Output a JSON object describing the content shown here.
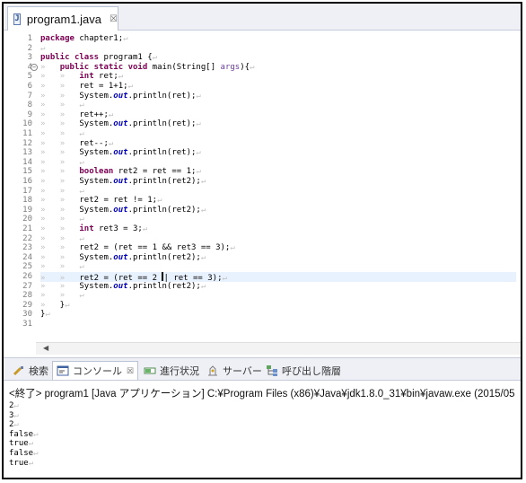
{
  "editor": {
    "tab": {
      "label": "program1.java",
      "icon": "java-file-icon",
      "close": "☒"
    },
    "lines": [
      {
        "n": "1",
        "text": "package chapter1;",
        "kind": "package"
      },
      {
        "n": "2",
        "text": "",
        "kind": "blank"
      },
      {
        "n": "3",
        "text": "public class program1 {",
        "kind": "class"
      },
      {
        "n": "4",
        "text": "public static void main(String[] args){",
        "kind": "main"
      },
      {
        "n": "5",
        "text": "int ret;",
        "kind": "decl"
      },
      {
        "n": "6",
        "text": "ret = 1+1;",
        "kind": "plain"
      },
      {
        "n": "7",
        "text": "System.out.println(ret);",
        "kind": "print"
      },
      {
        "n": "8",
        "text": "",
        "kind": "blank"
      },
      {
        "n": "9",
        "text": "ret++;",
        "kind": "plain"
      },
      {
        "n": "10",
        "text": "System.out.println(ret);",
        "kind": "print"
      },
      {
        "n": "11",
        "text": "",
        "kind": "blank"
      },
      {
        "n": "12",
        "text": "ret--;",
        "kind": "plain"
      },
      {
        "n": "13",
        "text": "System.out.println(ret);",
        "kind": "print"
      },
      {
        "n": "14",
        "text": "",
        "kind": "blank"
      },
      {
        "n": "15",
        "text": "boolean ret2 = ret == 1;",
        "kind": "decl"
      },
      {
        "n": "16",
        "text": "System.out.println(ret2);",
        "kind": "print"
      },
      {
        "n": "17",
        "text": "",
        "kind": "blank"
      },
      {
        "n": "18",
        "text": "ret2 = ret != 1;",
        "kind": "plain"
      },
      {
        "n": "19",
        "text": "System.out.println(ret2);",
        "kind": "print"
      },
      {
        "n": "20",
        "text": "",
        "kind": "blank"
      },
      {
        "n": "21",
        "text": "int ret3 = 3;",
        "kind": "decl"
      },
      {
        "n": "22",
        "text": "",
        "kind": "blank"
      },
      {
        "n": "23",
        "text": "ret2 = (ret == 1 && ret3 == 3);",
        "kind": "plain"
      },
      {
        "n": "24",
        "text": "System.out.println(ret2);",
        "kind": "print"
      },
      {
        "n": "25",
        "text": "",
        "kind": "blank"
      },
      {
        "n": "26",
        "text": "ret2 = (ret == 2 || ret == 3);",
        "kind": "current"
      },
      {
        "n": "27",
        "text": "System.out.println(ret2);",
        "kind": "print"
      },
      {
        "n": "28",
        "text": "",
        "kind": "blank"
      },
      {
        "n": "29",
        "text": "}",
        "kind": "close-inner"
      },
      {
        "n": "30",
        "text": "}",
        "kind": "close-outer"
      },
      {
        "n": "31",
        "text": "",
        "kind": "eof"
      }
    ],
    "line_end_marker": "↵",
    "tab_marker": "»"
  },
  "panel": {
    "tabs": [
      {
        "label": "検索",
        "icon": "search-icon",
        "active": false
      },
      {
        "label": "コンソール",
        "icon": "console-icon",
        "active": true,
        "close": "☒"
      },
      {
        "label": "進行状況",
        "icon": "progress-icon",
        "active": false
      },
      {
        "label": "サーバー",
        "icon": "servers-icon",
        "active": false
      },
      {
        "label": "呼び出し階層",
        "icon": "call-hierarchy-icon",
        "active": false
      }
    ],
    "console_header": "<終了> program1 [Java アプリケーション] C:¥Program Files (x86)¥Java¥jdk1.8.0_31¥bin¥javaw.exe (2015/05",
    "output": [
      "2",
      "3",
      "2",
      "false",
      "true",
      "false",
      "true"
    ]
  },
  "colors": {
    "keyword": "#7f0055",
    "variable": "#6a3e9e",
    "static_field": "#0000c0",
    "current_line": "#e8f2fe",
    "whitespace_marker": "#c2c2c2"
  }
}
